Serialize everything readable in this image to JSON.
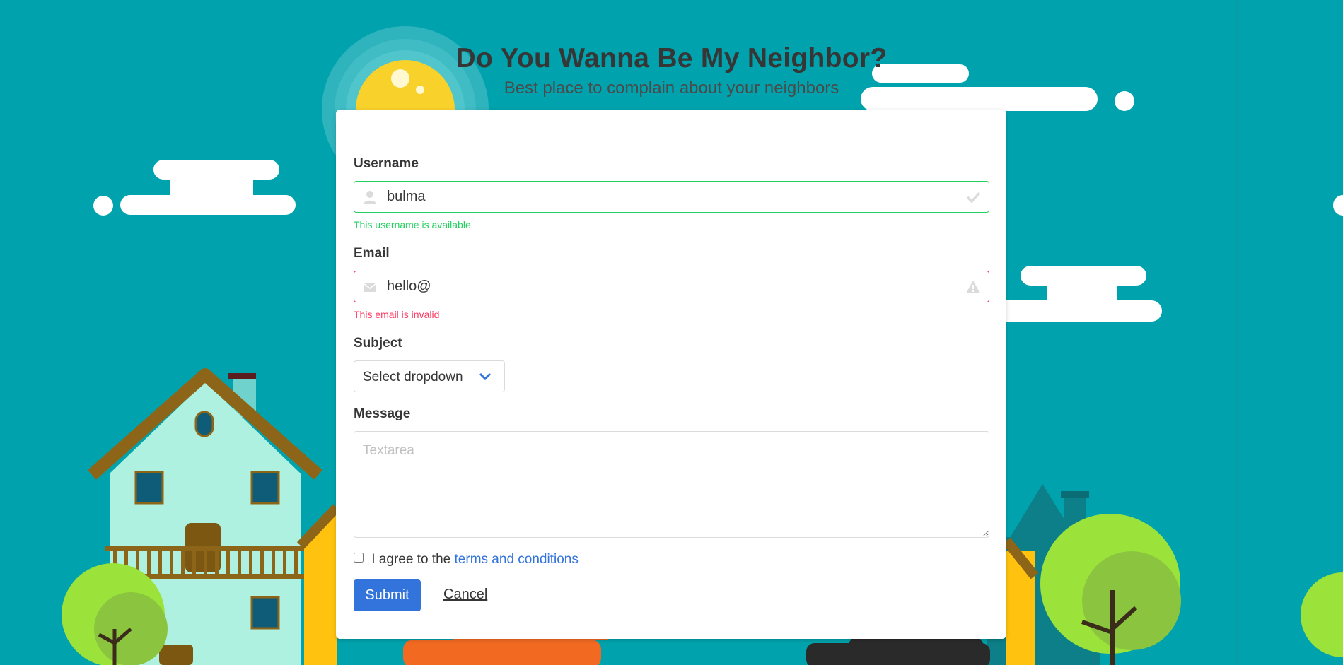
{
  "header": {
    "title": "Do You Wanna Be My Neighbor?",
    "subtitle": "Best place to complain about your neighbors"
  },
  "form": {
    "username": {
      "label": "Username",
      "value": "bulma",
      "icon_left": "user-icon",
      "icon_right": "check-icon",
      "help": "This username is available",
      "state": "success"
    },
    "email": {
      "label": "Email",
      "value": "hello@",
      "icon_left": "envelope-icon",
      "icon_right": "warning-icon",
      "help": "This email is invalid",
      "state": "danger"
    },
    "subject": {
      "label": "Subject",
      "selected": "Select dropdown",
      "icon": "chevron-down-icon"
    },
    "message": {
      "label": "Message",
      "placeholder": "Textarea",
      "value": ""
    },
    "terms": {
      "text": "I agree to the",
      "link_text": "terms and conditions",
      "checked": false
    },
    "submit_label": "Submit",
    "cancel_label": "Cancel"
  },
  "colors": {
    "background": "#00a3ad",
    "primary": "#3273dc",
    "success": "#23d160",
    "danger": "#ff3860"
  }
}
